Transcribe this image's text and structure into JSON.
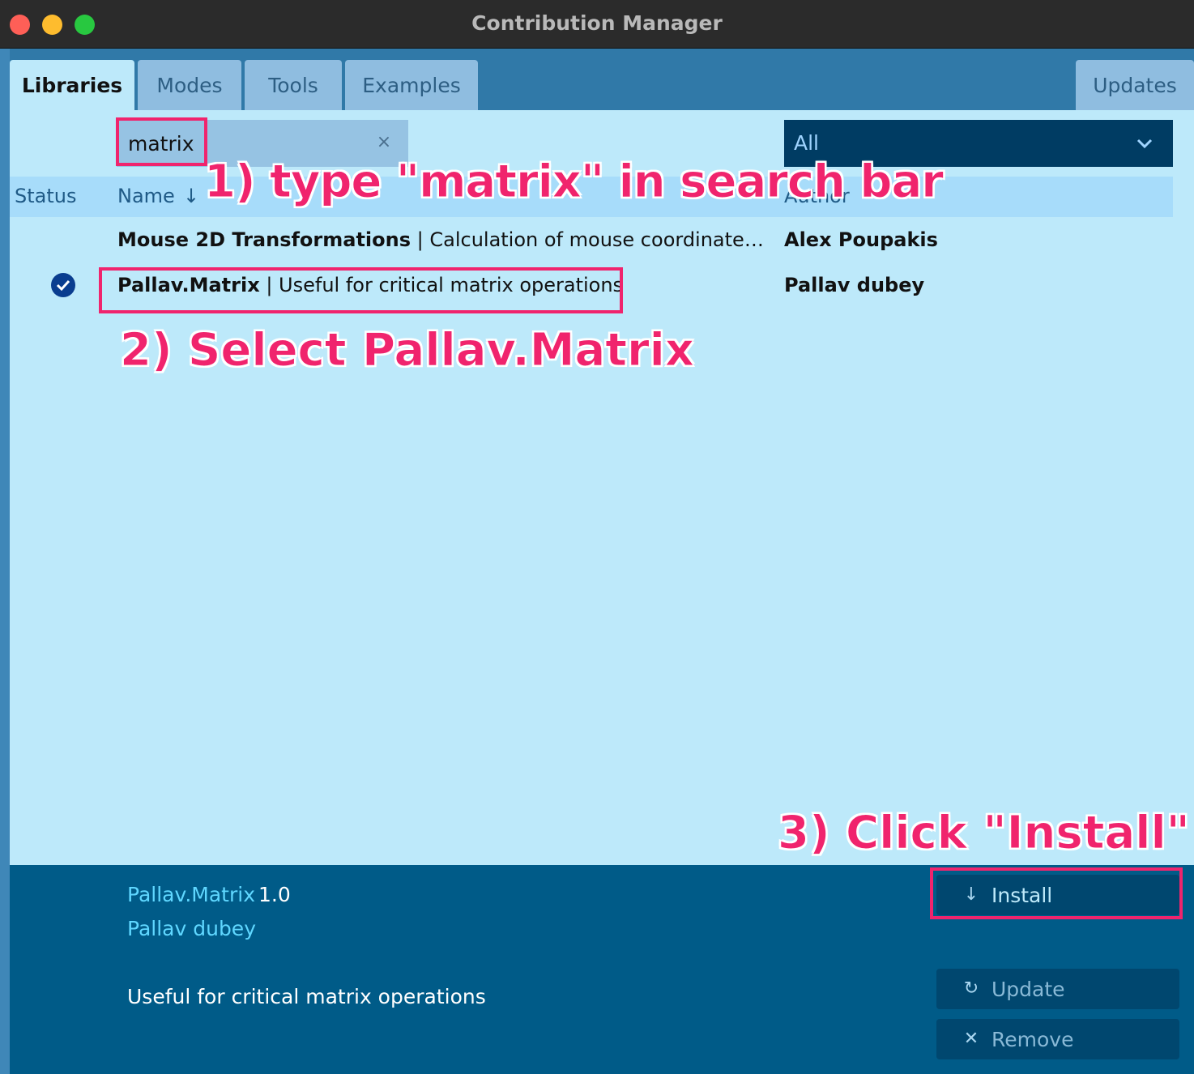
{
  "window": {
    "title": "Contribution Manager"
  },
  "tabs": [
    {
      "label": "Libraries",
      "active": true
    },
    {
      "label": "Modes"
    },
    {
      "label": "Tools"
    },
    {
      "label": "Examples"
    },
    {
      "label": "Updates"
    }
  ],
  "search": {
    "value": "matrix",
    "clear_icon": "×"
  },
  "filter": {
    "selected": "All"
  },
  "table": {
    "headers": {
      "status": "Status",
      "name": "Name",
      "sort_arrow": "↓",
      "author": "Author"
    },
    "rows": [
      {
        "title": "Mouse 2D Transformations",
        "separator": " | ",
        "description": "Calculation of mouse coordinates in …",
        "author": "Alex Poupakis",
        "installed": false
      },
      {
        "title": "Pallav.Matrix",
        "separator": " | ",
        "description": "Useful for critical matrix operations",
        "author": "Pallav dubey",
        "installed": true
      }
    ]
  },
  "details": {
    "name": "Pallav.Matrix",
    "version": "1.0",
    "author": "Pallav dubey",
    "description": "Useful for critical matrix operations"
  },
  "buttons": {
    "install": {
      "label": "Install",
      "icon": "↓"
    },
    "update": {
      "label": "Update",
      "icon": "↻"
    },
    "remove": {
      "label": "Remove",
      "icon": "✕"
    }
  },
  "annotations": {
    "step1": "1) type \"matrix\" in search bar",
    "step2": "2) Select Pallav.Matrix",
    "step3": "3) Click \"Install\""
  },
  "colors": {
    "highlight": "#f0246d",
    "pane": "#bde9fa",
    "details": "#005b88",
    "link": "#5fd7ff"
  }
}
